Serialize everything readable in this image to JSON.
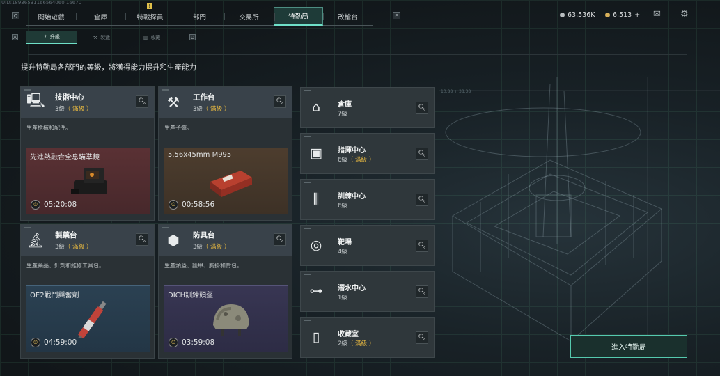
{
  "uid": "UID:18936531166564060 16670",
  "nav": {
    "left_key": "Q",
    "right_key": "E",
    "tabs": [
      {
        "label": "開始遊戲"
      },
      {
        "label": "倉庫"
      },
      {
        "label": "特戰探員",
        "alert": "!"
      },
      {
        "label": "部門"
      },
      {
        "label": "交易所"
      },
      {
        "label": "特勤局",
        "active": true
      },
      {
        "label": "改槍台"
      }
    ]
  },
  "header": {
    "coins": "63,536K",
    "tokens": "6,513",
    "plus": "+",
    "coin_color": "#b9bec0",
    "token_color": "#d8b15a",
    "mail_icon": "mail-icon",
    "settings_icon": "gear-icon"
  },
  "subnav": {
    "left_key": "A",
    "right_key": "D",
    "tabs": [
      {
        "label": "升級",
        "icon": "upgrade-icon",
        "active": true
      },
      {
        "label": "製造",
        "icon": "craft-icon"
      },
      {
        "label": "收藏",
        "icon": "collection-icon"
      }
    ]
  },
  "description": "提升特勤局各部門的等級，將獲得能力提升和生產能力",
  "cards": [
    {
      "title": "技術中心",
      "level": "3級",
      "max": "（ 滿級 ）",
      "desc": "生產槍械和配件。",
      "icon": "monitor-icon",
      "product": "先進熱融合全息瞄準鏡",
      "timer": "05:20:08",
      "theme": "red"
    },
    {
      "title": "工作台",
      "level": "3級",
      "max": "（ 滿級 ）",
      "desc": "生產子彈。",
      "icon": "tools-icon",
      "product": "5.56x45mm M995",
      "timer": "00:58:56",
      "theme": "brown"
    },
    {
      "title": "製藥台",
      "level": "3級",
      "max": "（ 滿級 ）",
      "desc": "生產藥品、針劑和維修工具包。",
      "icon": "microscope-icon",
      "product": "OE2戰鬥興奮劑",
      "timer": "04:59:00",
      "theme": "blue"
    },
    {
      "title": "防具台",
      "level": "3級",
      "max": "（ 滿級 ）",
      "desc": "生產頭盔、護甲、胸掛和背包。",
      "icon": "armor-blocks-icon",
      "product": "DICH訓練頭盔",
      "timer": "03:59:08",
      "theme": "purple"
    }
  ],
  "departments": [
    {
      "title": "倉庫",
      "level": "7級",
      "max": "",
      "icon": "warehouse-icon"
    },
    {
      "title": "指揮中心",
      "level": "6級",
      "max": "（ 滿級 ）",
      "icon": "command-chip-icon"
    },
    {
      "title": "訓練中心",
      "level": "6級",
      "max": "",
      "icon": "dumbbell-icon"
    },
    {
      "title": "靶場",
      "level": "4級",
      "max": "",
      "icon": "target-icon"
    },
    {
      "title": "潛水中心",
      "level": "1級",
      "max": "",
      "icon": "diving-mask-icon"
    },
    {
      "title": "收藏室",
      "level": "2級",
      "max": "（ 滿級 ）",
      "icon": "collection-room-icon"
    }
  ],
  "deco": {
    "a": "10.88 + 38.38"
  },
  "enter_button": "進入特勤局"
}
